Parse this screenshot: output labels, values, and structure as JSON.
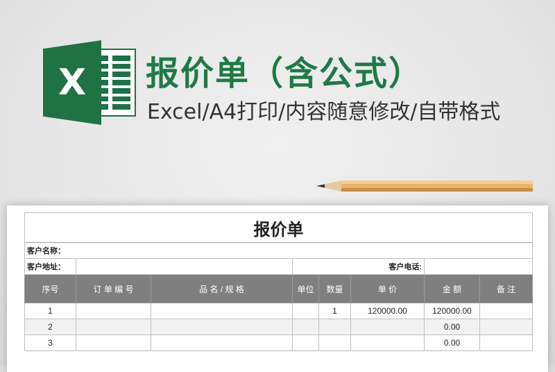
{
  "banner": {
    "title": "报价单（含公式）",
    "subtitle": "Excel/A4打印/内容随意修改/自带格式",
    "logo_letter": "X",
    "accent_color": "#1f7a46"
  },
  "sheet": {
    "doc_title": "报价单",
    "customer_name_label": "客户名称：",
    "customer_address_label": "客户地址：",
    "customer_phone_label": "客户电话:",
    "columns": [
      "序号",
      "订 单 编 号",
      "品 名 / 规 格",
      "单位",
      "数量",
      "单 价",
      "金 额",
      "备 注"
    ],
    "rows": [
      {
        "no": "1",
        "order": "",
        "name": "",
        "unit": "",
        "qty": "1",
        "price": "120000.00",
        "amount": "120000.00",
        "note": ""
      },
      {
        "no": "2",
        "order": "",
        "name": "",
        "unit": "",
        "qty": "",
        "price": "",
        "amount": "0.00",
        "note": ""
      },
      {
        "no": "3",
        "order": "",
        "name": "",
        "unit": "",
        "qty": "",
        "price": "",
        "amount": "0.00",
        "note": ""
      }
    ]
  }
}
